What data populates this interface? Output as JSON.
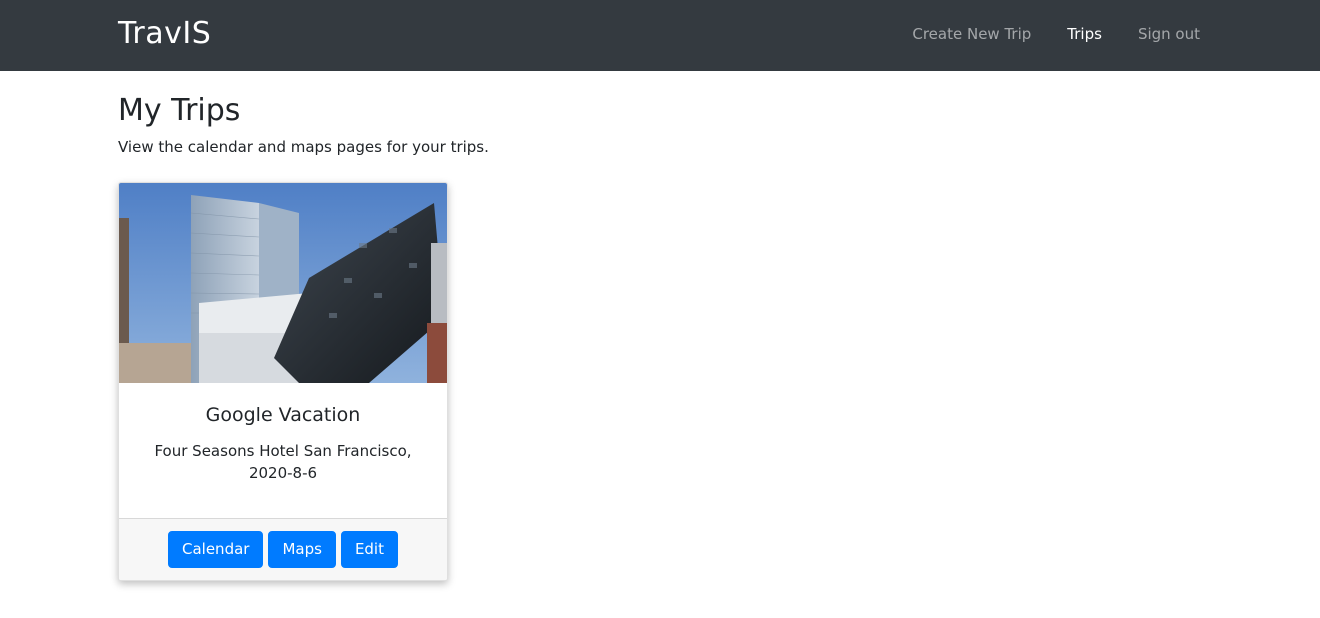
{
  "navbar": {
    "brand": "TravIS",
    "links": [
      {
        "label": "Create New Trip",
        "active": false
      },
      {
        "label": "Trips",
        "active": true
      },
      {
        "label": "Sign out",
        "active": false
      }
    ]
  },
  "main": {
    "title": "My Trips",
    "subtitle": "View the calendar and maps pages for your trips."
  },
  "trips": [
    {
      "image_icon": "building-photo",
      "name": "Google Vacation",
      "detail_line1": "Four Seasons Hotel San Francisco,",
      "detail_line2": "2020-8-6",
      "buttons": {
        "calendar": "Calendar",
        "maps": "Maps",
        "edit": "Edit"
      }
    }
  ],
  "colors": {
    "navbar_bg": "#343a40",
    "primary": "#007bff",
    "card_footer_bg": "#f7f7f7"
  }
}
